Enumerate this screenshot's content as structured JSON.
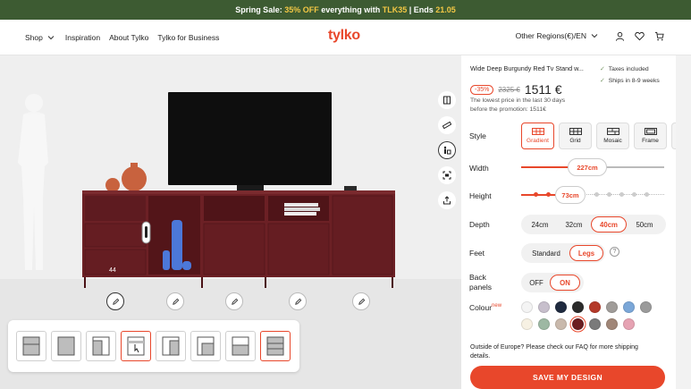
{
  "promo": {
    "prefix": "Spring Sale: ",
    "discount": "35% OFF",
    "middle": " everything with ",
    "code": "TLK35",
    "sep": " | Ends ",
    "date": "21.05"
  },
  "header": {
    "nav": [
      {
        "label": "Shop",
        "has_chevron": true
      },
      {
        "label": "Inspiration"
      },
      {
        "label": "About Tylko"
      },
      {
        "label": "Tylko for Business"
      }
    ],
    "logo": "tylko",
    "region": "Other Regions(€)/EN",
    "icons": [
      "user-icon",
      "heart-icon",
      "cart-icon"
    ]
  },
  "viewport": {
    "dimension_label": "44",
    "tools": [
      "book-icon",
      "ruler-icon",
      "figure-icon",
      "ar-icon",
      "share-icon"
    ],
    "edit_buttons": [
      "pencil-icon",
      "pencil-icon",
      "pencil-icon",
      "pencil-icon",
      "pencil-icon"
    ],
    "thumbnails": [
      "thumb-1",
      "thumb-2",
      "thumb-3",
      "thumb-4",
      "thumb-5",
      "thumb-6",
      "thumb-7",
      "thumb-8"
    ],
    "selected_thumbnails": [
      3,
      7
    ]
  },
  "product": {
    "title": "Wide Deep Burgundy Red Tv Stand w...",
    "checks": [
      "Taxes included",
      "Ships in 8-9 weeks"
    ],
    "discount_badge": "-35%",
    "old_price": "2325 €",
    "price": "1511 €",
    "lowest_line1": "The lowest price in the last 30 days",
    "lowest_line2": "before the promotion: 1511€"
  },
  "config": {
    "style_label": "Style",
    "styles": [
      {
        "label": "Gradient",
        "selected": true
      },
      {
        "label": "Grid"
      },
      {
        "label": "Mosaic"
      },
      {
        "label": "Frame"
      }
    ],
    "width_label": "Width",
    "width_value": "227cm",
    "height_label": "Height",
    "height_value": "73cm",
    "depth_label": "Depth",
    "depths": [
      {
        "label": "24cm"
      },
      {
        "label": "32cm"
      },
      {
        "label": "40cm",
        "selected": true
      },
      {
        "label": "50cm"
      }
    ],
    "feet_label": "Feet",
    "feet": [
      {
        "label": "Standard"
      },
      {
        "label": "Legs",
        "selected": true
      }
    ],
    "back_label_1": "Back",
    "back_label_2": "panels",
    "back": [
      {
        "label": "OFF"
      },
      {
        "label": "ON",
        "selected": true
      }
    ],
    "colour_label": "Colour",
    "colour_new_tag": "new",
    "colours": [
      "#f4f4f4",
      "#c7bfcc",
      "#1f2a3f",
      "#2b2b2b",
      "#b43a2a",
      "#a09c99",
      "#7ba7d8",
      "#9b9b9b",
      "#f7f1e3",
      "#9db8a3",
      "#c9b9ac",
      "#6b1d20",
      "#7a7a7a",
      "#a08677",
      "#e6a3b3"
    ],
    "selected_colour_index": 11
  },
  "footer": {
    "note": "Outside of Europe? Please check our FAQ for more shipping details.",
    "cta": "SAVE MY DESIGN"
  }
}
